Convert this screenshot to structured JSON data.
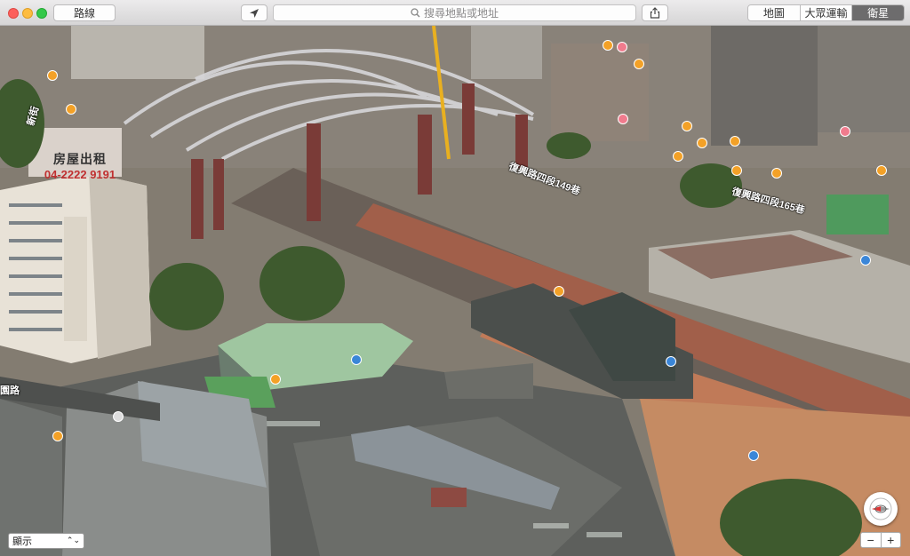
{
  "toolbar": {
    "route_label": "路線",
    "search_placeholder": "搜尋地點或地址",
    "map_types": [
      "地圖",
      "大眾運輸",
      "衛星"
    ],
    "selected_map_type": "衛星"
  },
  "map": {
    "street_labels": [
      "復興路四段149巷",
      "復興路四段165巷",
      "新街",
      "園路"
    ],
    "billboard_text": [
      "房屋出租",
      "04-2222 9191"
    ]
  },
  "controls": {
    "display_option": "顯示",
    "zoom_out": "−",
    "zoom_in": "+"
  },
  "colors": {
    "poi_orange": "#f3a127",
    "poi_pink": "#f07b8d",
    "poi_blue": "#3a86d8",
    "selected_segment": "#6d6c6d"
  }
}
